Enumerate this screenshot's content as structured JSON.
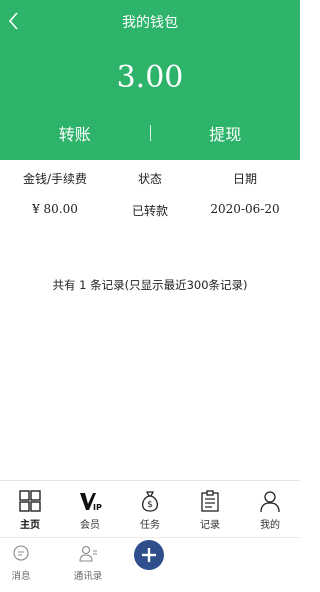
{
  "header": {
    "title": "我的钱包",
    "balance": "3.00",
    "transfer_label": "转账",
    "withdraw_label": "提现"
  },
  "table": {
    "headers": [
      "金钱/手续费",
      "状态",
      "日期"
    ],
    "rows": [
      {
        "amount": "¥ 80.00",
        "status": "已转款",
        "date": "2020-06-20"
      }
    ]
  },
  "summary_text": "共有 1 条记录(只显示最近300条记录)",
  "tabbar": {
    "items": [
      {
        "label": "主页",
        "icon": "grid-icon"
      },
      {
        "label": "会员",
        "icon": "vip-icon"
      },
      {
        "label": "任务",
        "icon": "money-bag-icon"
      },
      {
        "label": "记录",
        "icon": "clipboard-icon"
      },
      {
        "label": "我的",
        "icon": "person-icon"
      }
    ]
  },
  "secondary_bar": {
    "messages_label": "消息",
    "contacts_label": "通讯录"
  },
  "colors": {
    "header_bg": "#2db36a",
    "fab_bg": "#2f4f8c"
  }
}
